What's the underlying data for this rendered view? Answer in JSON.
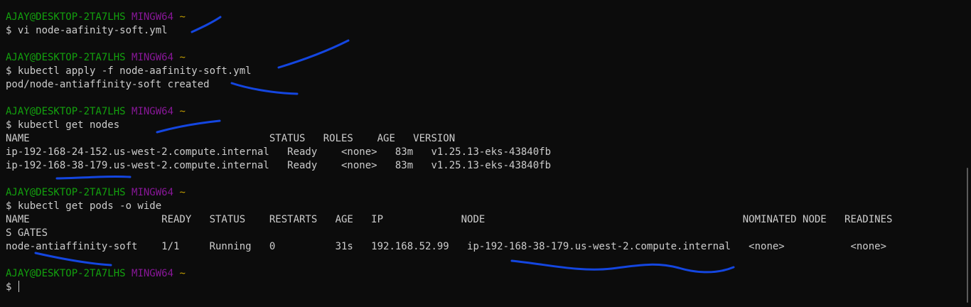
{
  "prompt": {
    "user_host": "AJAY@DESKTOP-2TA7LHS",
    "shell": "MINGW64",
    "path": "~"
  },
  "lines": {
    "l0": "$ vi node-aafinity-soft.yml",
    "l1": "$ kubectl apply -f node-aafinity-soft.yml",
    "l2": "pod/node-antiaffinity-soft created",
    "l3": "$ kubectl get nodes",
    "l4": "NAME                                        STATUS   ROLES    AGE   VERSION",
    "l5": "ip-192-168-24-152.us-west-2.compute.internal   Ready    <none>   83m   v1.25.13-eks-43840fb",
    "l6": "ip-192-168-38-179.us-west-2.compute.internal   Ready    <none>   83m   v1.25.13-eks-43840fb",
    "l7": "$ kubectl get pods -o wide",
    "l8": "NAME                      READY   STATUS    RESTARTS   AGE   IP             NODE                                           NOMINATED NODE   READINES",
    "l9": "S GATES",
    "l10": "node-antiaffinity-soft    1/1     Running   0          31s   192.168.52.99   ip-192-168-38-179.us-west-2.compute.internal   <none>           <none>",
    "l11": "$ "
  },
  "colors": {
    "background": "#0c0c0c",
    "text": "#cccccc",
    "user_host": "#13a10e",
    "shell": "#881798",
    "tilde": "#c19c00",
    "annotation": "#1446e0"
  }
}
